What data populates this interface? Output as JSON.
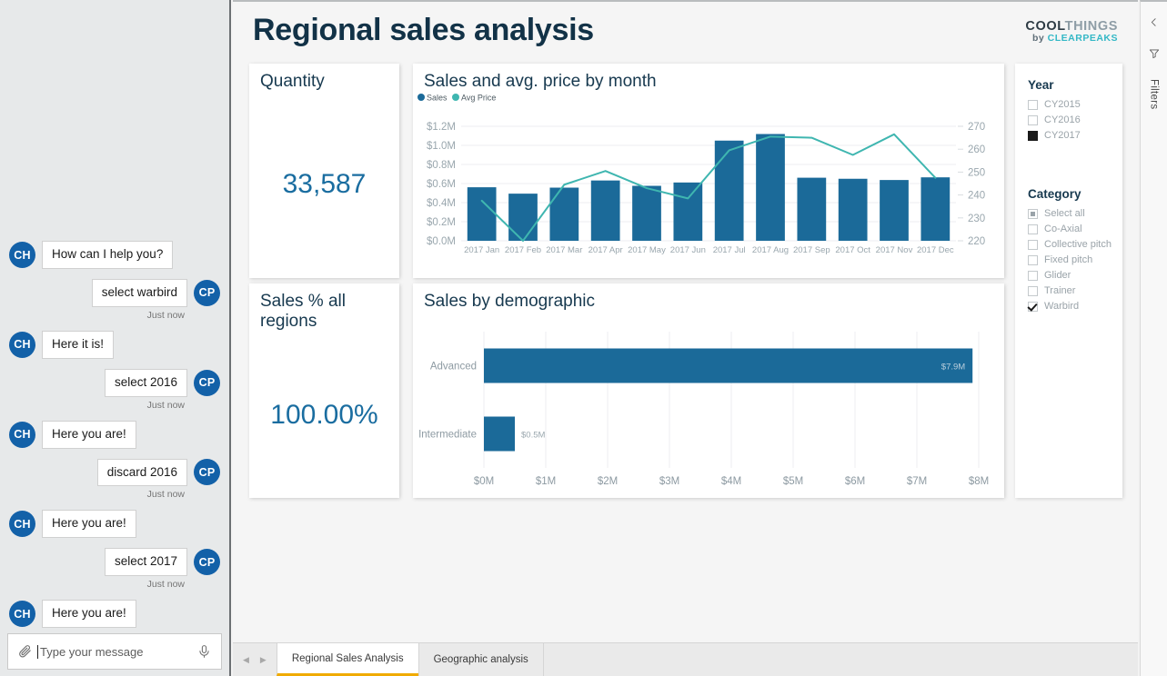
{
  "chat": {
    "messages": [
      {
        "side": "bot",
        "avatar": "CH",
        "text": "How can I help you?",
        "timestamp": ""
      },
      {
        "side": "user",
        "avatar": "CP",
        "text": "select warbird",
        "timestamp": "Just now"
      },
      {
        "side": "bot",
        "avatar": "CH",
        "text": "Here it is!",
        "timestamp": ""
      },
      {
        "side": "user",
        "avatar": "CP",
        "text": "select 2016",
        "timestamp": "Just now"
      },
      {
        "side": "bot",
        "avatar": "CH",
        "text": "Here you are!",
        "timestamp": ""
      },
      {
        "side": "user",
        "avatar": "CP",
        "text": "discard 2016",
        "timestamp": "Just now"
      },
      {
        "side": "bot",
        "avatar": "CH",
        "text": "Here you are!",
        "timestamp": ""
      },
      {
        "side": "user",
        "avatar": "CP",
        "text": "select 2017",
        "timestamp": "Just now"
      },
      {
        "side": "bot",
        "avatar": "CH",
        "text": "Here you are!",
        "timestamp": ""
      }
    ],
    "input": {
      "placeholder": "Type your message",
      "value": "",
      "attach_icon": "paperclip-icon",
      "mic_icon": "microphone-icon"
    }
  },
  "report": {
    "title": "Regional sales analysis",
    "logo": {
      "part1": "COOL",
      "part2": "THINGS",
      "by": "by ",
      "brand": "CLEARPEAKS"
    },
    "kpis": [
      {
        "title": "Quantity",
        "value": "33,587"
      },
      {
        "title": "Sales % all regions",
        "value": "100.00%"
      }
    ]
  },
  "filters": {
    "groups": [
      {
        "title": "Year",
        "items": [
          {
            "label": "CY2015",
            "state": "unchecked"
          },
          {
            "label": "CY2016",
            "state": "unchecked"
          },
          {
            "label": "CY2017",
            "state": "filled"
          }
        ]
      },
      {
        "title": "Category",
        "items": [
          {
            "label": "Select all",
            "state": "partial"
          },
          {
            "label": "Co-Axial",
            "state": "unchecked"
          },
          {
            "label": "Collective pitch",
            "state": "unchecked"
          },
          {
            "label": "Fixed pitch",
            "state": "unchecked"
          },
          {
            "label": "Glider",
            "state": "unchecked"
          },
          {
            "label": "Trainer",
            "state": "unchecked"
          },
          {
            "label": "Warbird",
            "state": "checked"
          }
        ]
      }
    ]
  },
  "tabs": {
    "prev_icon": "chevron-left-icon",
    "next_icon": "chevron-right-icon",
    "items": [
      {
        "label": "Regional Sales Analysis",
        "active": true
      },
      {
        "label": "Geographic analysis",
        "active": false
      }
    ]
  },
  "right_rail": {
    "collapse_icon": "chevron-left-icon",
    "filter_icon": "funnel-icon",
    "label": "Filters"
  },
  "colors": {
    "bar": "#1b6a99",
    "line": "#3fb6b0",
    "title": "#123247",
    "kpi_value": "#1a6da0",
    "accent_tab": "#f0ab00",
    "brand_teal": "#34b8c6"
  },
  "chart_data": [
    {
      "type": "bar",
      "title": "Sales and avg. price by month",
      "xlabel": "",
      "ylabel": "",
      "grid": true,
      "legend": [
        "Sales",
        "Avg Price"
      ],
      "legend_position": "top-left",
      "categories": [
        "2017 Jan",
        "2017 Feb",
        "2017 Mar",
        "2017 Apr",
        "2017 May",
        "2017 Jun",
        "2017 Jul",
        "2017 Aug",
        "2017 Sep",
        "2017 Oct",
        "2017 Nov",
        "2017 Dec"
      ],
      "y_ticks": [
        "$0.0M",
        "$0.2M",
        "$0.4M",
        "$0.6M",
        "$0.8M",
        "$1.0M",
        "$1.2M"
      ],
      "ylim": [
        0,
        1.2
      ],
      "y2_ticks": [
        "220",
        "230",
        "240",
        "250",
        "260",
        "270"
      ],
      "y2lim": [
        220,
        270
      ],
      "series": [
        {
          "name": "Sales",
          "kind": "bar",
          "axis": "left",
          "values": [
            0.561,
            0.494,
            0.557,
            0.632,
            0.576,
            0.611,
            1.05,
            1.119,
            0.661,
            0.65,
            0.637,
            0.665
          ]
        },
        {
          "name": "Avg Price",
          "kind": "line",
          "axis": "right",
          "values": [
            237.5,
            220.0,
            244.5,
            250.5,
            243.0,
            238.5,
            259.5,
            265.5,
            265.0,
            257.5,
            266.5,
            247.5
          ]
        }
      ]
    },
    {
      "type": "bar",
      "orientation": "horizontal",
      "title": "Sales by demographic",
      "xlabel": "",
      "ylabel": "",
      "grid": true,
      "categories": [
        "Advanced",
        "Intermediate"
      ],
      "values": [
        7.9,
        0.5
      ],
      "data_labels": [
        "$7.9M",
        "$0.5M"
      ],
      "x_ticks": [
        "$0M",
        "$1M",
        "$2M",
        "$3M",
        "$4M",
        "$5M",
        "$6M",
        "$7M",
        "$8M"
      ],
      "xlim": [
        0,
        8
      ]
    }
  ]
}
